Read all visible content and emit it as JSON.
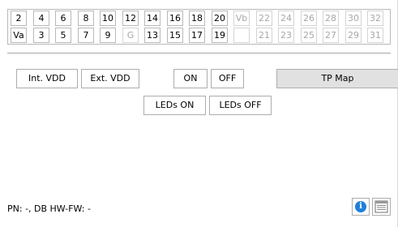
{
  "pin_grid": {
    "top_row": [
      {
        "label": "2",
        "disabled": false
      },
      {
        "label": "4",
        "disabled": false
      },
      {
        "label": "6",
        "disabled": false
      },
      {
        "label": "8",
        "disabled": false
      },
      {
        "label": "10",
        "disabled": false
      },
      {
        "label": "12",
        "disabled": false
      },
      {
        "label": "14",
        "disabled": false
      },
      {
        "label": "16",
        "disabled": false
      },
      {
        "label": "18",
        "disabled": false
      },
      {
        "label": "20",
        "disabled": false
      },
      {
        "label": "Vb",
        "disabled": true
      },
      {
        "label": "22",
        "disabled": true
      },
      {
        "label": "24",
        "disabled": true
      },
      {
        "label": "26",
        "disabled": true
      },
      {
        "label": "28",
        "disabled": true
      },
      {
        "label": "30",
        "disabled": true
      },
      {
        "label": "32",
        "disabled": true
      }
    ],
    "bottom_row": [
      {
        "label": "Va",
        "disabled": false
      },
      {
        "label": "3",
        "disabled": false
      },
      {
        "label": "5",
        "disabled": false
      },
      {
        "label": "7",
        "disabled": false
      },
      {
        "label": "9",
        "disabled": false
      },
      {
        "label": "G",
        "disabled": true
      },
      {
        "label": "13",
        "disabled": false
      },
      {
        "label": "15",
        "disabled": false
      },
      {
        "label": "17",
        "disabled": false
      },
      {
        "label": "19",
        "disabled": false
      },
      {
        "label": "",
        "disabled": true
      },
      {
        "label": "21",
        "disabled": true
      },
      {
        "label": "23",
        "disabled": true
      },
      {
        "label": "25",
        "disabled": true
      },
      {
        "label": "27",
        "disabled": true
      },
      {
        "label": "29",
        "disabled": true
      },
      {
        "label": "31",
        "disabled": true
      }
    ]
  },
  "controls": {
    "int_vdd": "Int. VDD",
    "ext_vdd": "Ext. VDD",
    "on": "ON",
    "off": "OFF",
    "tp_map": "TP Map",
    "leds_on": "LEDs ON",
    "leds_off": "LEDs OFF"
  },
  "status": {
    "text": "PN: -, DB HW-FW: -"
  },
  "footer": {
    "info_icon": "info-icon",
    "list_icon": "list-icon",
    "info_color": "#1f7fd8"
  }
}
